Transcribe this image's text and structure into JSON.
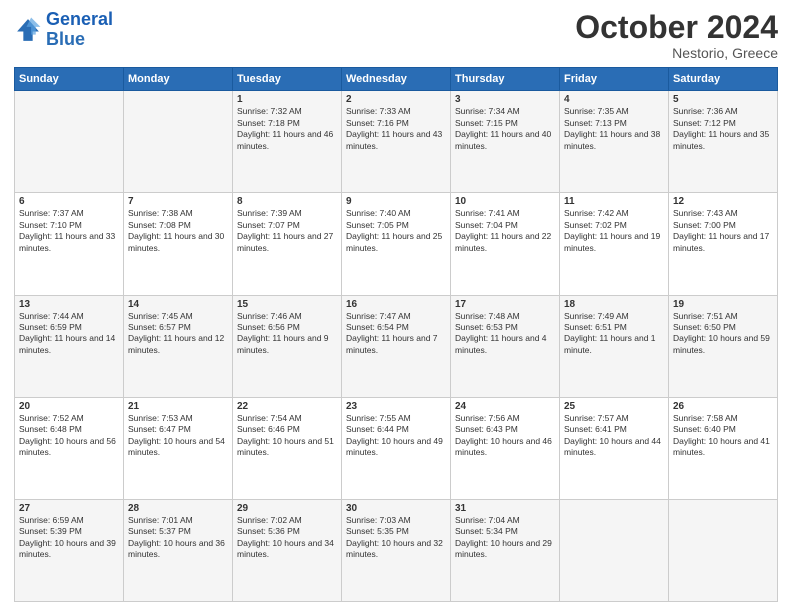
{
  "logo": {
    "line1": "General",
    "line2": "Blue"
  },
  "title": "October 2024",
  "location": "Nestorio, Greece",
  "headers": [
    "Sunday",
    "Monday",
    "Tuesday",
    "Wednesday",
    "Thursday",
    "Friday",
    "Saturday"
  ],
  "rows": [
    [
      {
        "day": "",
        "sunrise": "",
        "sunset": "",
        "daylight": ""
      },
      {
        "day": "",
        "sunrise": "",
        "sunset": "",
        "daylight": ""
      },
      {
        "day": "1",
        "sunrise": "Sunrise: 7:32 AM",
        "sunset": "Sunset: 7:18 PM",
        "daylight": "Daylight: 11 hours and 46 minutes."
      },
      {
        "day": "2",
        "sunrise": "Sunrise: 7:33 AM",
        "sunset": "Sunset: 7:16 PM",
        "daylight": "Daylight: 11 hours and 43 minutes."
      },
      {
        "day": "3",
        "sunrise": "Sunrise: 7:34 AM",
        "sunset": "Sunset: 7:15 PM",
        "daylight": "Daylight: 11 hours and 40 minutes."
      },
      {
        "day": "4",
        "sunrise": "Sunrise: 7:35 AM",
        "sunset": "Sunset: 7:13 PM",
        "daylight": "Daylight: 11 hours and 38 minutes."
      },
      {
        "day": "5",
        "sunrise": "Sunrise: 7:36 AM",
        "sunset": "Sunset: 7:12 PM",
        "daylight": "Daylight: 11 hours and 35 minutes."
      }
    ],
    [
      {
        "day": "6",
        "sunrise": "Sunrise: 7:37 AM",
        "sunset": "Sunset: 7:10 PM",
        "daylight": "Daylight: 11 hours and 33 minutes."
      },
      {
        "day": "7",
        "sunrise": "Sunrise: 7:38 AM",
        "sunset": "Sunset: 7:08 PM",
        "daylight": "Daylight: 11 hours and 30 minutes."
      },
      {
        "day": "8",
        "sunrise": "Sunrise: 7:39 AM",
        "sunset": "Sunset: 7:07 PM",
        "daylight": "Daylight: 11 hours and 27 minutes."
      },
      {
        "day": "9",
        "sunrise": "Sunrise: 7:40 AM",
        "sunset": "Sunset: 7:05 PM",
        "daylight": "Daylight: 11 hours and 25 minutes."
      },
      {
        "day": "10",
        "sunrise": "Sunrise: 7:41 AM",
        "sunset": "Sunset: 7:04 PM",
        "daylight": "Daylight: 11 hours and 22 minutes."
      },
      {
        "day": "11",
        "sunrise": "Sunrise: 7:42 AM",
        "sunset": "Sunset: 7:02 PM",
        "daylight": "Daylight: 11 hours and 19 minutes."
      },
      {
        "day": "12",
        "sunrise": "Sunrise: 7:43 AM",
        "sunset": "Sunset: 7:00 PM",
        "daylight": "Daylight: 11 hours and 17 minutes."
      }
    ],
    [
      {
        "day": "13",
        "sunrise": "Sunrise: 7:44 AM",
        "sunset": "Sunset: 6:59 PM",
        "daylight": "Daylight: 11 hours and 14 minutes."
      },
      {
        "day": "14",
        "sunrise": "Sunrise: 7:45 AM",
        "sunset": "Sunset: 6:57 PM",
        "daylight": "Daylight: 11 hours and 12 minutes."
      },
      {
        "day": "15",
        "sunrise": "Sunrise: 7:46 AM",
        "sunset": "Sunset: 6:56 PM",
        "daylight": "Daylight: 11 hours and 9 minutes."
      },
      {
        "day": "16",
        "sunrise": "Sunrise: 7:47 AM",
        "sunset": "Sunset: 6:54 PM",
        "daylight": "Daylight: 11 hours and 7 minutes."
      },
      {
        "day": "17",
        "sunrise": "Sunrise: 7:48 AM",
        "sunset": "Sunset: 6:53 PM",
        "daylight": "Daylight: 11 hours and 4 minutes."
      },
      {
        "day": "18",
        "sunrise": "Sunrise: 7:49 AM",
        "sunset": "Sunset: 6:51 PM",
        "daylight": "Daylight: 11 hours and 1 minute."
      },
      {
        "day": "19",
        "sunrise": "Sunrise: 7:51 AM",
        "sunset": "Sunset: 6:50 PM",
        "daylight": "Daylight: 10 hours and 59 minutes."
      }
    ],
    [
      {
        "day": "20",
        "sunrise": "Sunrise: 7:52 AM",
        "sunset": "Sunset: 6:48 PM",
        "daylight": "Daylight: 10 hours and 56 minutes."
      },
      {
        "day": "21",
        "sunrise": "Sunrise: 7:53 AM",
        "sunset": "Sunset: 6:47 PM",
        "daylight": "Daylight: 10 hours and 54 minutes."
      },
      {
        "day": "22",
        "sunrise": "Sunrise: 7:54 AM",
        "sunset": "Sunset: 6:46 PM",
        "daylight": "Daylight: 10 hours and 51 minutes."
      },
      {
        "day": "23",
        "sunrise": "Sunrise: 7:55 AM",
        "sunset": "Sunset: 6:44 PM",
        "daylight": "Daylight: 10 hours and 49 minutes."
      },
      {
        "day": "24",
        "sunrise": "Sunrise: 7:56 AM",
        "sunset": "Sunset: 6:43 PM",
        "daylight": "Daylight: 10 hours and 46 minutes."
      },
      {
        "day": "25",
        "sunrise": "Sunrise: 7:57 AM",
        "sunset": "Sunset: 6:41 PM",
        "daylight": "Daylight: 10 hours and 44 minutes."
      },
      {
        "day": "26",
        "sunrise": "Sunrise: 7:58 AM",
        "sunset": "Sunset: 6:40 PM",
        "daylight": "Daylight: 10 hours and 41 minutes."
      }
    ],
    [
      {
        "day": "27",
        "sunrise": "Sunrise: 6:59 AM",
        "sunset": "Sunset: 5:39 PM",
        "daylight": "Daylight: 10 hours and 39 minutes."
      },
      {
        "day": "28",
        "sunrise": "Sunrise: 7:01 AM",
        "sunset": "Sunset: 5:37 PM",
        "daylight": "Daylight: 10 hours and 36 minutes."
      },
      {
        "day": "29",
        "sunrise": "Sunrise: 7:02 AM",
        "sunset": "Sunset: 5:36 PM",
        "daylight": "Daylight: 10 hours and 34 minutes."
      },
      {
        "day": "30",
        "sunrise": "Sunrise: 7:03 AM",
        "sunset": "Sunset: 5:35 PM",
        "daylight": "Daylight: 10 hours and 32 minutes."
      },
      {
        "day": "31",
        "sunrise": "Sunrise: 7:04 AM",
        "sunset": "Sunset: 5:34 PM",
        "daylight": "Daylight: 10 hours and 29 minutes."
      },
      {
        "day": "",
        "sunrise": "",
        "sunset": "",
        "daylight": ""
      },
      {
        "day": "",
        "sunrise": "",
        "sunset": "",
        "daylight": ""
      }
    ]
  ]
}
